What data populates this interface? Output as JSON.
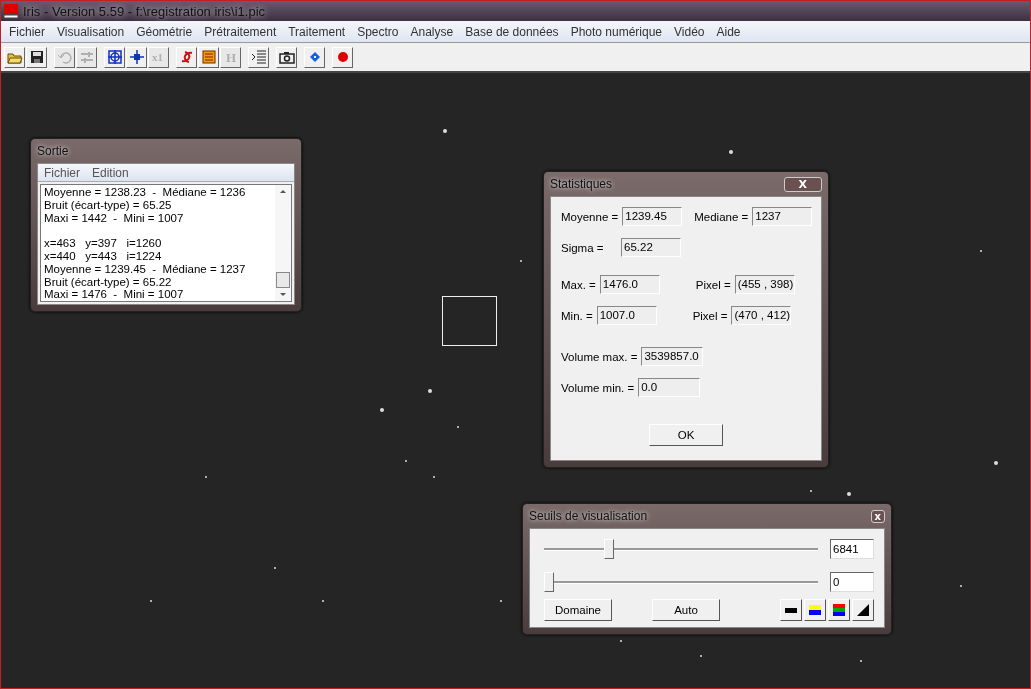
{
  "window": {
    "title": "Iris - Version 5.59 - f:\\registration iris\\i1.pic"
  },
  "menu": [
    "Fichier",
    "Visualisation",
    "Géométrie",
    "Prétraitement",
    "Traitement",
    "Spectro",
    "Analyse",
    "Base de données",
    "Photo numérique",
    "Vidéo",
    "Aide"
  ],
  "toolbar": [
    {
      "kind": "open",
      "disabled": false
    },
    {
      "kind": "save",
      "disabled": false
    },
    {
      "kind": "undo",
      "disabled": true
    },
    {
      "kind": "sliders",
      "disabled": true
    },
    {
      "kind": "crosshair",
      "disabled": false
    },
    {
      "kind": "move",
      "disabled": false
    },
    {
      "kind": "x1",
      "disabled": true
    },
    {
      "kind": "swirl",
      "disabled": false
    },
    {
      "kind": "list",
      "disabled": false
    },
    {
      "kind": "H",
      "disabled": true
    },
    {
      "kind": "lines",
      "disabled": false
    },
    {
      "kind": "camera",
      "disabled": false
    },
    {
      "kind": "diamond",
      "disabled": false
    },
    {
      "kind": "record",
      "disabled": false
    }
  ],
  "output_window": {
    "title": "Sortie",
    "menu": [
      "Fichier",
      "Edition"
    ],
    "blocks": [
      [
        "Moyenne = 1238.23  -  Médiane = 1236",
        "Bruit (écart-type) = 65.25",
        "Maxi = 1442  -  Mini = 1007"
      ],
      [
        "x=463   y=397   i=1260",
        "x=440   y=443   i=1224",
        "Moyenne = 1239.45  -  Médiane = 1237",
        "Bruit (écart-type) = 65.22",
        "Maxi = 1476  -  Mini = 1007"
      ]
    ]
  },
  "statistics_window": {
    "title": "Statistiques",
    "close": "X",
    "rows": [
      [
        {
          "label": "Moyenne =",
          "value": "1239.45"
        },
        {
          "label": "Mediane =",
          "value": "1237"
        }
      ],
      [
        {
          "label": "Sigma =",
          "value": "65.22"
        }
      ],
      [
        {
          "label": "Max. =",
          "value": "1476.0"
        },
        {
          "label": "Pixel =",
          "value": "(455 , 398)"
        }
      ],
      [
        {
          "label": "Min. =",
          "value": "1007.0"
        },
        {
          "label": "Pixel =",
          "value": "(470 , 412)"
        }
      ],
      [
        {
          "label": "Volume max. =",
          "value": "3539857.0"
        }
      ],
      [
        {
          "label": "Volume min. =",
          "value": "0.0"
        }
      ]
    ],
    "ok": "OK"
  },
  "thresholds_window": {
    "title": "Seuils de visualisation",
    "close": "x",
    "sliders": [
      {
        "level": 0.22,
        "value": "6841"
      },
      {
        "level": 0.0,
        "value": "0"
      }
    ],
    "buttons": [
      "Domaine",
      "Auto"
    ],
    "palettes": [
      {
        "kind": "bw"
      },
      {
        "kind": "yellow-blue"
      },
      {
        "kind": "rgb"
      },
      {
        "kind": "ramp"
      }
    ]
  }
}
